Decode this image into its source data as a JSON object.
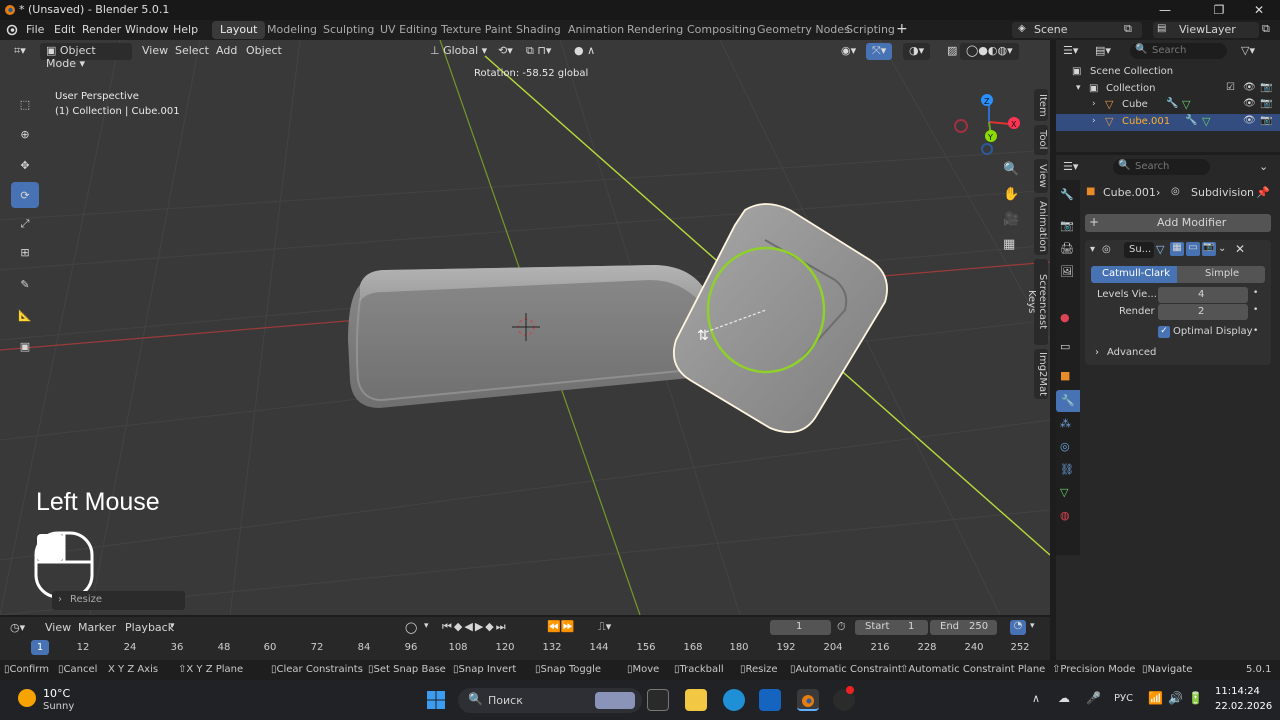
{
  "window": {
    "title": "* (Unsaved) - Blender 5.0.1"
  },
  "menubar": {
    "items": [
      "File",
      "Edit",
      "Render",
      "Window",
      "Help"
    ],
    "workspaces": [
      "Layout",
      "Modeling",
      "Sculpting",
      "UV Editing",
      "Texture Paint",
      "Shading",
      "Animation",
      "Rendering",
      "Compositing",
      "Geometry Nodes",
      "Scripting"
    ],
    "scene": "Scene",
    "view_layer": "ViewLayer"
  },
  "viewport": {
    "mode": "Object Mode",
    "menus": [
      "View",
      "Select",
      "Add",
      "Object"
    ],
    "transform_orientation": "Global",
    "rotation_readout": "Rotation: -58.52 global",
    "perspective_label": "User Perspective",
    "collection_label": "(1) Collection | Cube.001",
    "side_tabs": [
      "Item",
      "Tool",
      "View",
      "Animation",
      "Screencast Keys",
      "Img2Mat"
    ],
    "gizmo_axes": [
      "X",
      "Y",
      "Z"
    ],
    "screencast_label": "Left Mouse",
    "last_operator": "Resize"
  },
  "outliner": {
    "search_placeholder": "Search",
    "root": "Scene Collection",
    "collection": "Collection",
    "objects": [
      "Cube",
      "Cube.001"
    ]
  },
  "properties": {
    "search_placeholder": "Search",
    "breadcrumb_object": "Cube.001",
    "breadcrumb_modifier": "Subdivision",
    "add_modifier": "Add Modifier",
    "modifier_name": "Su...",
    "mode_options": [
      "Catmull-Clark",
      "Simple"
    ],
    "levels_viewport_label": "Levels Vie...",
    "levels_viewport": "4",
    "render_label": "Render",
    "render_value": "2",
    "optimal_display": "Optimal Display",
    "advanced": "Advanced"
  },
  "timeline": {
    "menus": [
      "View",
      "Marker",
      "Playback"
    ],
    "current_frame": "1",
    "start_label": "Start",
    "start": "1",
    "end_label": "End",
    "end": "250",
    "frame_ticks": [
      "1",
      "12",
      "24",
      "36",
      "48",
      "60",
      "72",
      "84",
      "96",
      "108",
      "120",
      "132",
      "144",
      "156",
      "168",
      "180",
      "192",
      "204",
      "216",
      "228",
      "240",
      "252"
    ]
  },
  "statusbar": {
    "items": [
      "Confirm",
      "Cancel",
      "X Y Z Axis",
      "X Y Z Plane",
      "Clear Constraints",
      "Set Snap Base",
      "Snap Invert",
      "Snap Toggle",
      "Move",
      "Trackball",
      "Resize",
      "Automatic Constraint",
      "Automatic Constraint Plane",
      "Precision Mode",
      "Navigate"
    ],
    "version": "5.0.1"
  },
  "taskbar": {
    "weather_temp": "10°C",
    "weather_desc": "Sunny",
    "search_placeholder": "Поиск",
    "language": "РУС",
    "time": "11:14:24",
    "date": "22.02.2026"
  },
  "colors": {
    "accent": "#4772b3",
    "selection": "#334d80",
    "active_object": "#ffaf29",
    "x_axis": "#ff3352",
    "y_axis": "#8bdc00",
    "z_axis": "#2890ff"
  }
}
